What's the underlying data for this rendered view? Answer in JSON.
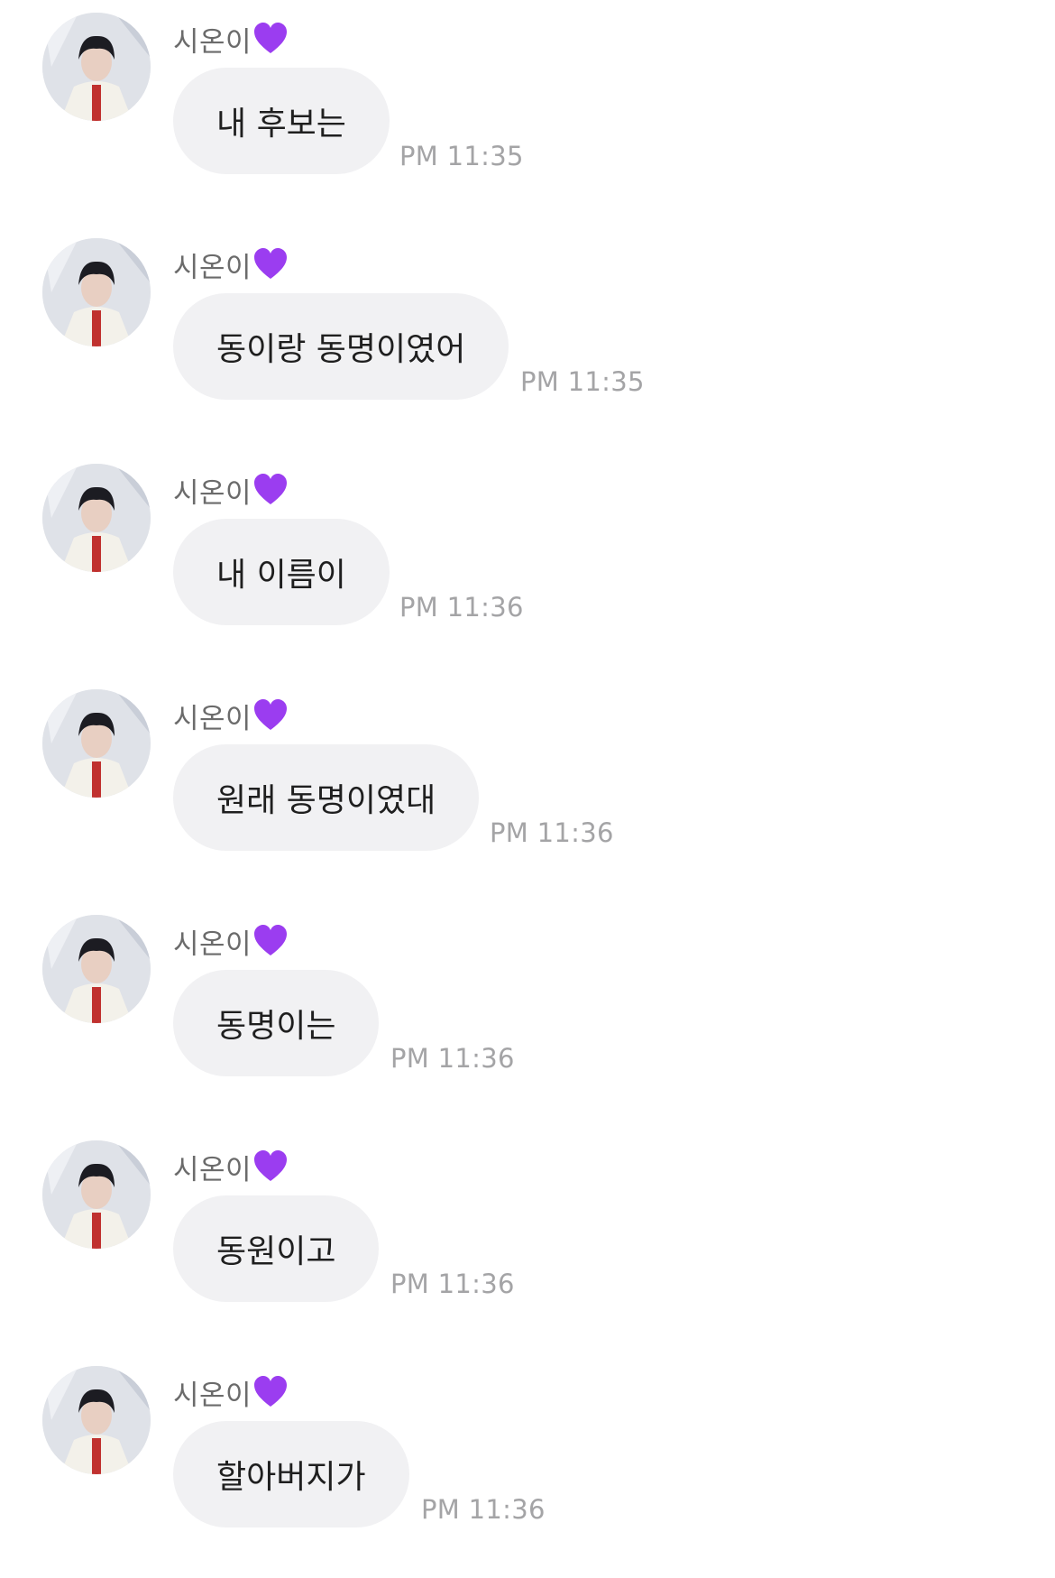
{
  "sender_name": "시온이",
  "sender_emoji": "purple-heart",
  "colors": {
    "bubble": "#f1f1f3",
    "heart": "#9b3df0",
    "timestamp": "#a4a4a6"
  },
  "messages": [
    {
      "text": "내 후보는",
      "time": "PM 11:35"
    },
    {
      "text": "동이랑 동명이였어",
      "time": "PM 11:35"
    },
    {
      "text": "내 이름이",
      "time": "PM 11:36"
    },
    {
      "text": "원래 동명이였대",
      "time": "PM 11:36"
    },
    {
      "text": "동명이는",
      "time": "PM 11:36"
    },
    {
      "text": "동원이고",
      "time": "PM 11:36"
    },
    {
      "text": "할아버지가",
      "time": "PM 11:36"
    }
  ]
}
